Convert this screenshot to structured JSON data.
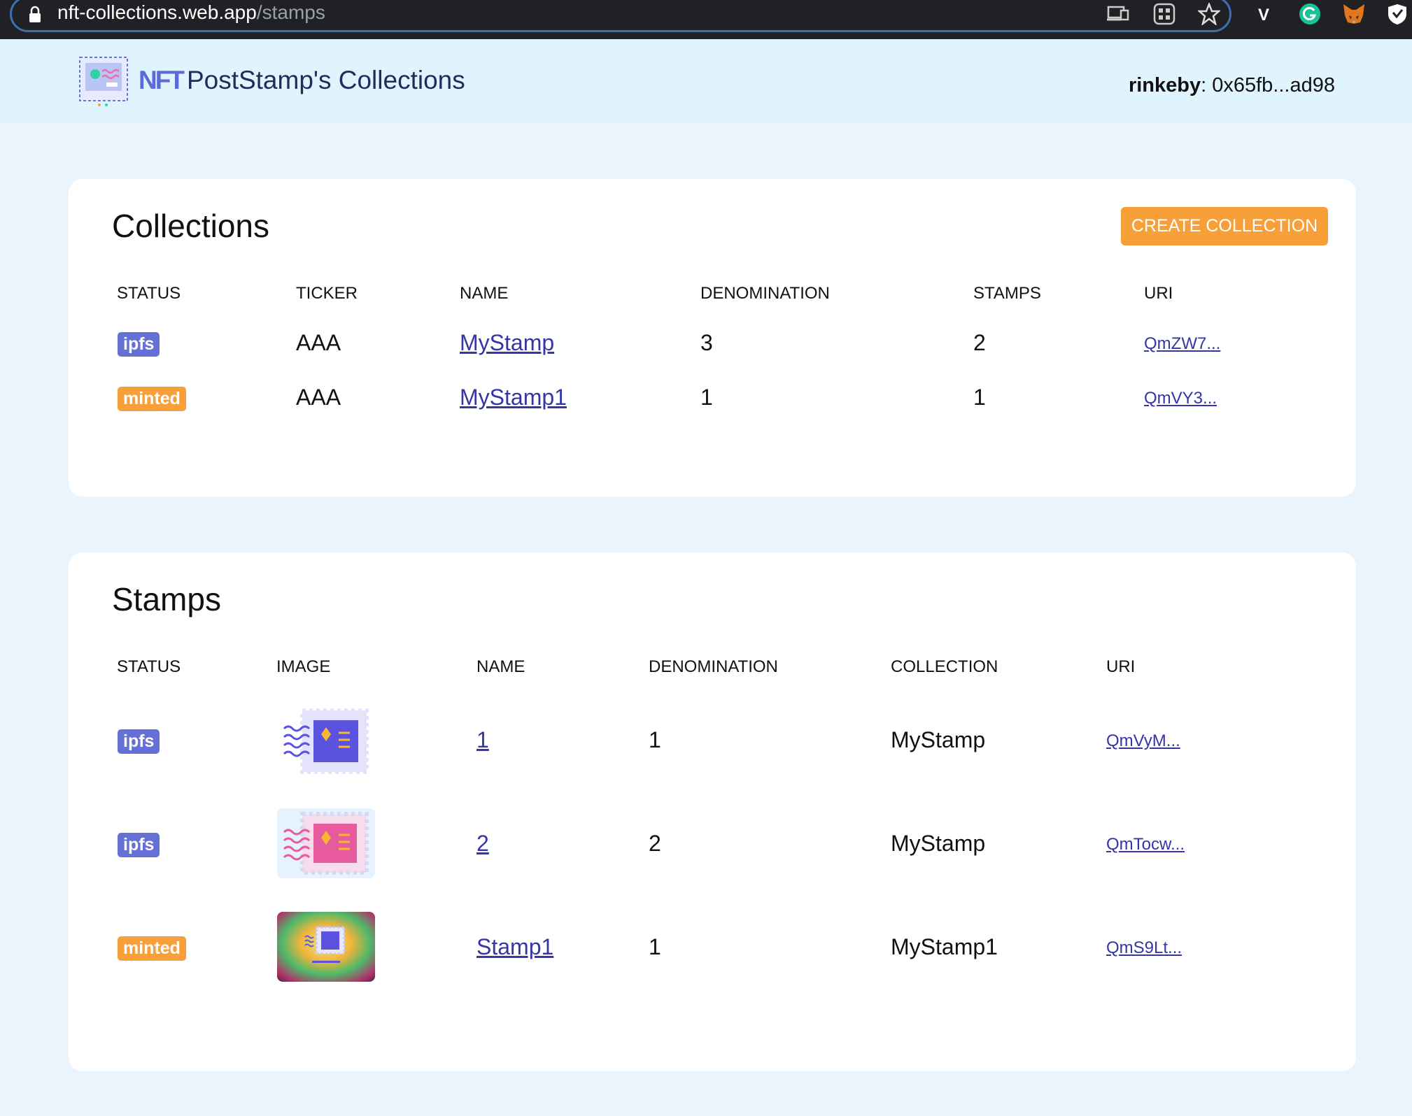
{
  "browser": {
    "url_host": "nft-collections.web.app",
    "url_path": "/stamps",
    "extension_v_label": "V"
  },
  "header": {
    "brand_nft": "NFT",
    "brand_title": "PostStamp's Collections",
    "network": "rinkeby",
    "address": ": 0x65fb...ad98"
  },
  "collections": {
    "title": "Collections",
    "create_label": "CREATE COLLECTION",
    "headers": [
      "STATUS",
      "TICKER",
      "NAME",
      "DENOMINATION",
      "STAMPS",
      "URI"
    ],
    "rows": [
      {
        "status": "ipfs",
        "ticker": "AAA",
        "name": "MyStamp",
        "denomination": "3",
        "stamps": "2",
        "uri": "QmZW7..."
      },
      {
        "status": "minted",
        "ticker": "AAA",
        "name": "MyStamp1",
        "denomination": "1",
        "stamps": "1",
        "uri": "QmVY3..."
      }
    ]
  },
  "stamps": {
    "title": "Stamps",
    "headers": [
      "STATUS",
      "IMAGE",
      "NAME",
      "DENOMINATION",
      "COLLECTION",
      "URI"
    ],
    "rows": [
      {
        "status": "ipfs",
        "image": "stamp-blue-icon",
        "name": "1",
        "denomination": "1",
        "collection": "MyStamp",
        "uri": "QmVyM..."
      },
      {
        "status": "ipfs",
        "image": "stamp-pink-icon",
        "name": "2",
        "denomination": "2",
        "collection": "MyStamp",
        "uri": "QmTocw..."
      },
      {
        "status": "minted",
        "image": "stamp-gradient-image",
        "name": "Stamp1",
        "denomination": "1",
        "collection": "MyStamp1",
        "uri": "QmS9Lt..."
      }
    ]
  },
  "colors": {
    "accent_orange": "#f7a03a",
    "ipfs_badge": "#6470d6",
    "page_bg": "#e9f4fd",
    "header_bg": "#dff4fd"
  }
}
